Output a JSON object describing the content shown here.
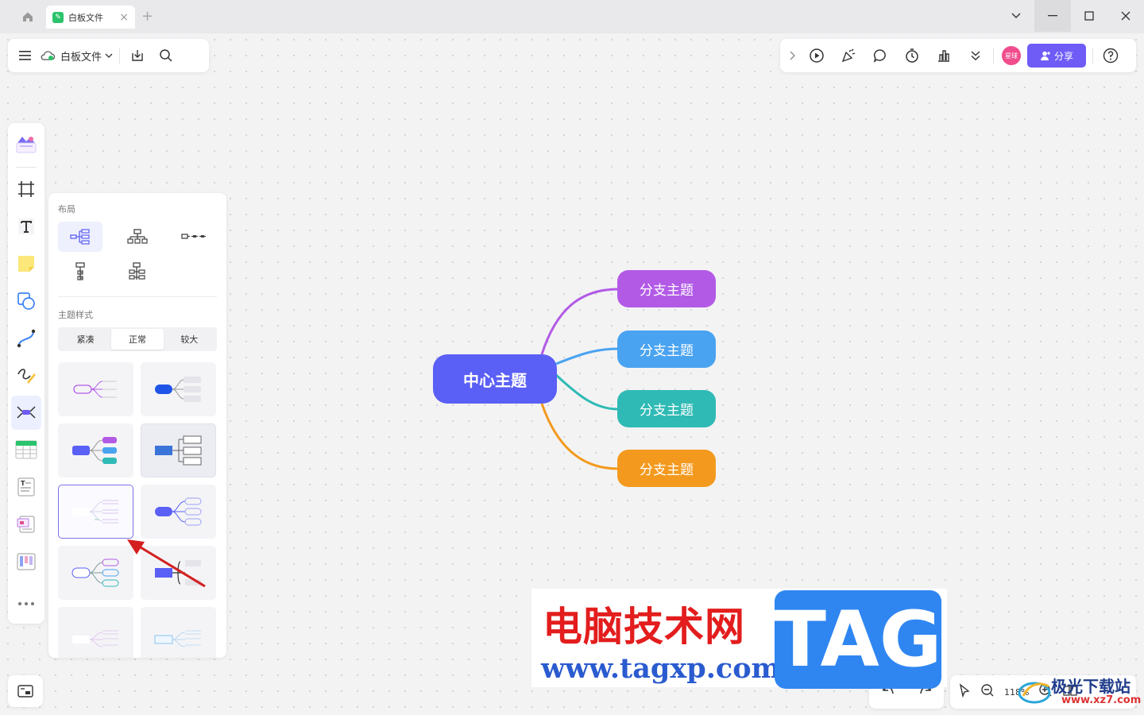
{
  "titlebar": {
    "tab_title": "白板文件",
    "new_tab": "+"
  },
  "toolbar_left": {
    "file_name": "白板文件"
  },
  "toolbar_right": {
    "avatar_label": "星球",
    "share_label": "分享"
  },
  "panel": {
    "layout_label": "布局",
    "theme_label": "主题样式",
    "density_options": [
      "紧凑",
      "正常",
      "较大"
    ],
    "density_selected": "正常"
  },
  "mindmap": {
    "center": "中心主题",
    "branches": [
      {
        "label": "分支主题",
        "color": "#b25ae6"
      },
      {
        "label": "分支主题",
        "color": "#4aa3f0"
      },
      {
        "label": "分支主题",
        "color": "#2fbab5"
      },
      {
        "label": "分支主题",
        "color": "#f39a1e"
      }
    ],
    "center_color": "#5a5ff5"
  },
  "zoom": {
    "level": "118%"
  },
  "watermark": {
    "cn_text": "电脑技术网",
    "url": "www.tagxp.com",
    "tag": "TAG",
    "site2_text": "极光下载站",
    "site2_url": "www.xz7.com"
  },
  "colors": {
    "accent": "#6f5cf6",
    "arrow": "#d42020"
  }
}
